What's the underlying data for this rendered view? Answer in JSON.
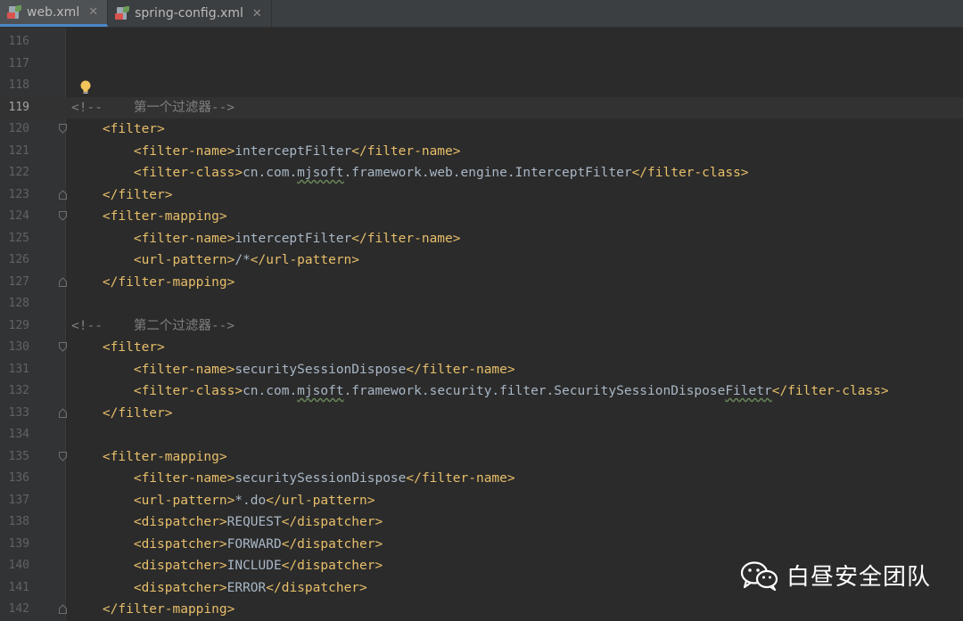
{
  "tabs": [
    {
      "label": "web.xml",
      "active": true
    },
    {
      "label": "spring-config.xml",
      "active": false
    }
  ],
  "watermark": {
    "text": "白昼安全团队"
  },
  "lines": [
    {
      "n": "116",
      "parts": []
    },
    {
      "n": "117",
      "parts": []
    },
    {
      "n": "118",
      "parts": []
    },
    {
      "n": "119",
      "parts": [
        {
          "c": "cmt",
          "t": "<!--    第一个过滤器-->"
        }
      ]
    },
    {
      "n": "120",
      "fold": "open",
      "parts": [
        {
          "c": "tag",
          "t": "    <filter>"
        }
      ]
    },
    {
      "n": "121",
      "parts": [
        {
          "c": "tag",
          "t": "        <filter-name>"
        },
        {
          "c": "txt",
          "t": "interceptFilter"
        },
        {
          "c": "tag",
          "t": "</filter-name>"
        }
      ]
    },
    {
      "n": "122",
      "parts": [
        {
          "c": "tag",
          "t": "        <filter-class>"
        },
        {
          "c": "txt",
          "t": "cn.com."
        },
        {
          "c": "txt squig",
          "t": "mjsoft"
        },
        {
          "c": "txt",
          "t": ".framework.web.engine.InterceptFilter"
        },
        {
          "c": "tag",
          "t": "</filter-class>"
        }
      ]
    },
    {
      "n": "123",
      "fold": "close",
      "parts": [
        {
          "c": "tag",
          "t": "    </filter>"
        }
      ]
    },
    {
      "n": "124",
      "fold": "open",
      "parts": [
        {
          "c": "tag",
          "t": "    <filter-mapping>"
        }
      ]
    },
    {
      "n": "125",
      "parts": [
        {
          "c": "tag",
          "t": "        <filter-name>"
        },
        {
          "c": "txt",
          "t": "interceptFilter"
        },
        {
          "c": "tag",
          "t": "</filter-name>"
        }
      ]
    },
    {
      "n": "126",
      "parts": [
        {
          "c": "tag",
          "t": "        <url-pattern>"
        },
        {
          "c": "txt",
          "t": "/*"
        },
        {
          "c": "tag",
          "t": "</url-pattern>"
        }
      ]
    },
    {
      "n": "127",
      "fold": "close",
      "parts": [
        {
          "c": "tag",
          "t": "    </filter-mapping>"
        }
      ]
    },
    {
      "n": "128",
      "parts": []
    },
    {
      "n": "129",
      "parts": [
        {
          "c": "cmt",
          "t": "<!--    第二个过滤器-->"
        }
      ]
    },
    {
      "n": "130",
      "fold": "open",
      "parts": [
        {
          "c": "tag",
          "t": "    <filter>"
        }
      ]
    },
    {
      "n": "131",
      "parts": [
        {
          "c": "tag",
          "t": "        <filter-name>"
        },
        {
          "c": "txt",
          "t": "securitySessionDispose"
        },
        {
          "c": "tag",
          "t": "</filter-name>"
        }
      ]
    },
    {
      "n": "132",
      "parts": [
        {
          "c": "tag",
          "t": "        <filter-class>"
        },
        {
          "c": "txt",
          "t": "cn.com."
        },
        {
          "c": "txt squig",
          "t": "mjsoft"
        },
        {
          "c": "txt",
          "t": ".framework.security.filter.SecuritySessionDispose"
        },
        {
          "c": "txt squig",
          "t": "Filetr"
        },
        {
          "c": "tag",
          "t": "</filter-class>"
        }
      ]
    },
    {
      "n": "133",
      "fold": "close",
      "parts": [
        {
          "c": "tag",
          "t": "    </filter>"
        }
      ]
    },
    {
      "n": "134",
      "parts": []
    },
    {
      "n": "135",
      "fold": "open",
      "parts": [
        {
          "c": "tag",
          "t": "    <filter-mapping>"
        }
      ]
    },
    {
      "n": "136",
      "parts": [
        {
          "c": "tag",
          "t": "        <filter-name>"
        },
        {
          "c": "txt",
          "t": "securitySessionDispose"
        },
        {
          "c": "tag",
          "t": "</filter-name>"
        }
      ]
    },
    {
      "n": "137",
      "parts": [
        {
          "c": "tag",
          "t": "        <url-pattern>"
        },
        {
          "c": "txt",
          "t": "*.do"
        },
        {
          "c": "tag",
          "t": "</url-pattern>"
        }
      ]
    },
    {
      "n": "138",
      "parts": [
        {
          "c": "tag",
          "t": "        <dispatcher>"
        },
        {
          "c": "txt",
          "t": "REQUEST"
        },
        {
          "c": "tag",
          "t": "</dispatcher>"
        }
      ]
    },
    {
      "n": "139",
      "parts": [
        {
          "c": "tag",
          "t": "        <dispatcher>"
        },
        {
          "c": "txt",
          "t": "FORWARD"
        },
        {
          "c": "tag",
          "t": "</dispatcher>"
        }
      ]
    },
    {
      "n": "140",
      "parts": [
        {
          "c": "tag",
          "t": "        <dispatcher>"
        },
        {
          "c": "txt",
          "t": "INCLUDE"
        },
        {
          "c": "tag",
          "t": "</dispatcher>"
        }
      ]
    },
    {
      "n": "141",
      "parts": [
        {
          "c": "tag",
          "t": "        <dispatcher>"
        },
        {
          "c": "txt",
          "t": "ERROR"
        },
        {
          "c": "tag",
          "t": "</dispatcher>"
        }
      ]
    },
    {
      "n": "142",
      "fold": "close",
      "parts": [
        {
          "c": "tag",
          "t": "    </filter-mapping>"
        }
      ]
    }
  ],
  "current_line": "119",
  "colors": {
    "background": "#2b2b2b",
    "tag": "#e8bf6a",
    "text": "#a9b7c6",
    "comment": "#808080"
  }
}
